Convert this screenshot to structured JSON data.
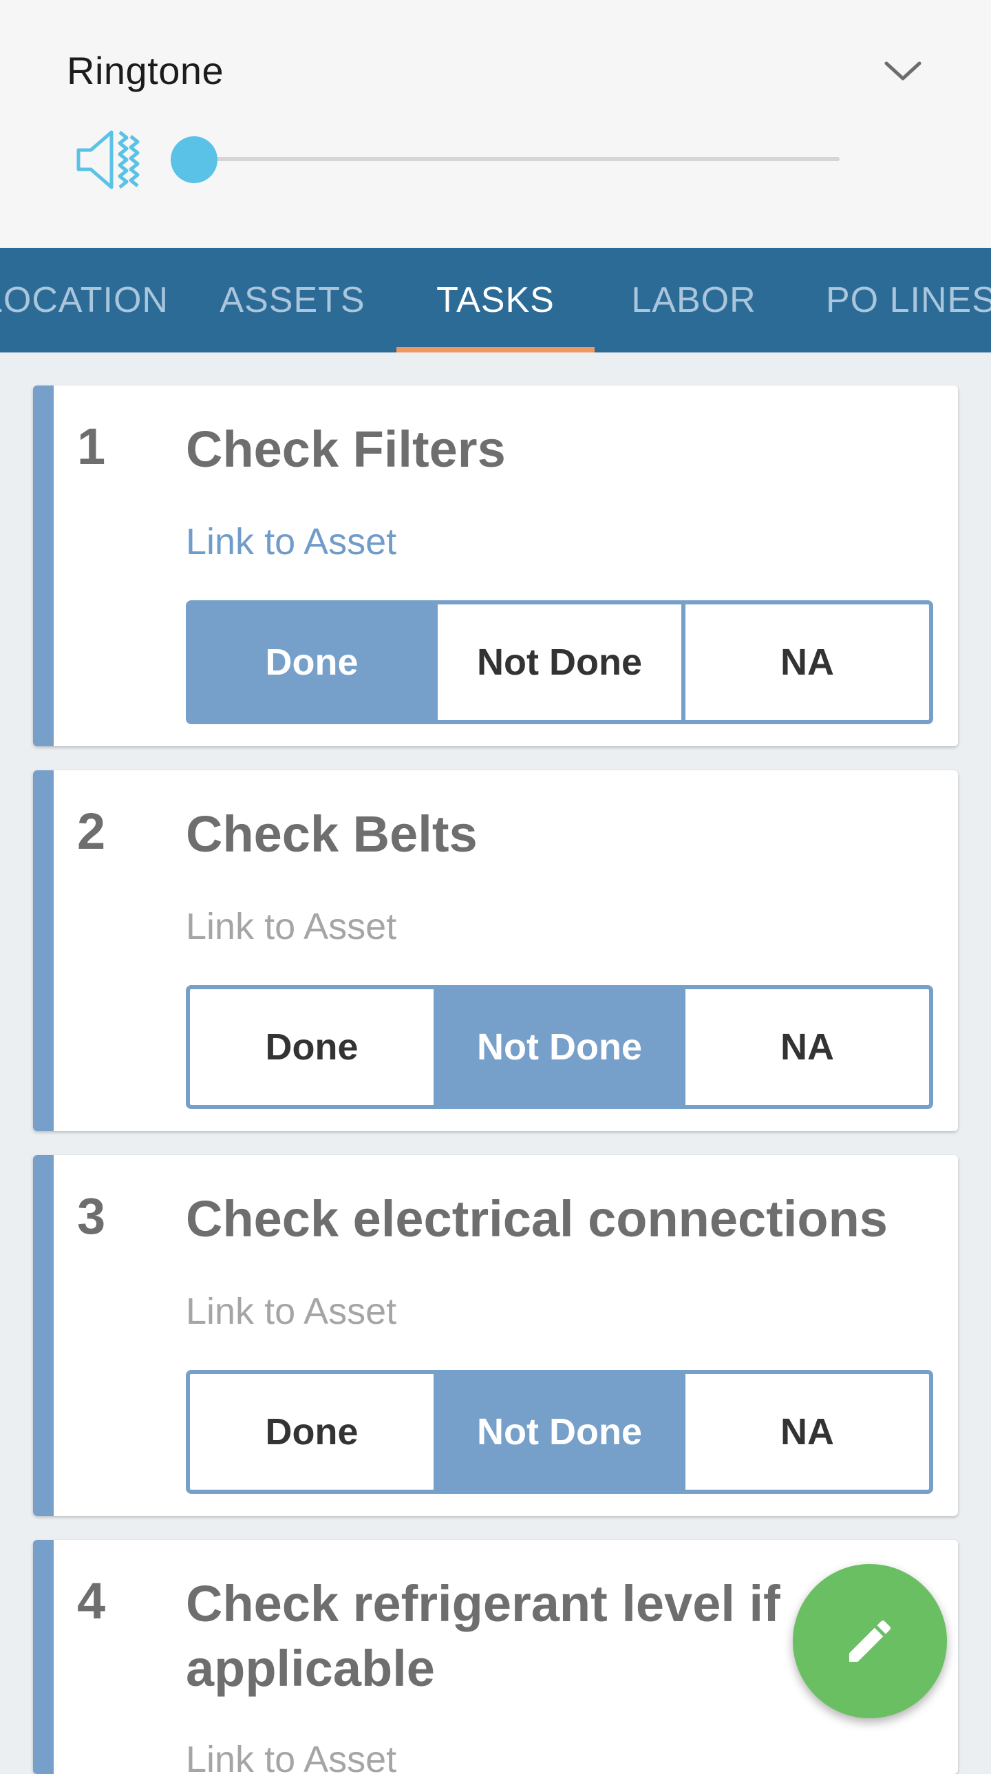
{
  "volume_panel": {
    "title": "Ringtone",
    "level": 0,
    "accent_color": "#59c2e6"
  },
  "tabs": [
    {
      "label": "LOCATION",
      "active": false
    },
    {
      "label": "ASSETS",
      "active": false
    },
    {
      "label": "TASKS",
      "active": true
    },
    {
      "label": "LABOR",
      "active": false
    },
    {
      "label": "PO LINES",
      "active": false
    }
  ],
  "tasks": [
    {
      "number": "1",
      "title": "Check Filters",
      "link": "Link to Asset",
      "link_active": true,
      "options": [
        "Done",
        "Not Done",
        "NA"
      ],
      "selected": "Done"
    },
    {
      "number": "2",
      "title": "Check Belts",
      "link": "Link to Asset",
      "link_active": false,
      "options": [
        "Done",
        "Not Done",
        "NA"
      ],
      "selected": "Not Done"
    },
    {
      "number": "3",
      "title": "Check electrical connections",
      "link": "Link to Asset",
      "link_active": false,
      "options": [
        "Done",
        "Not Done",
        "NA"
      ],
      "selected": "Not Done"
    },
    {
      "number": "4",
      "title": "Check refrigerant level if applicable",
      "link": "Link to Asset",
      "link_active": false
    }
  ],
  "fab": {
    "icon": "pencil-icon",
    "color": "#6abf62"
  },
  "colors": {
    "tab_bar": "#2d6b97",
    "tab_indicator": "#f0975f",
    "task_accent": "#769fc9"
  }
}
